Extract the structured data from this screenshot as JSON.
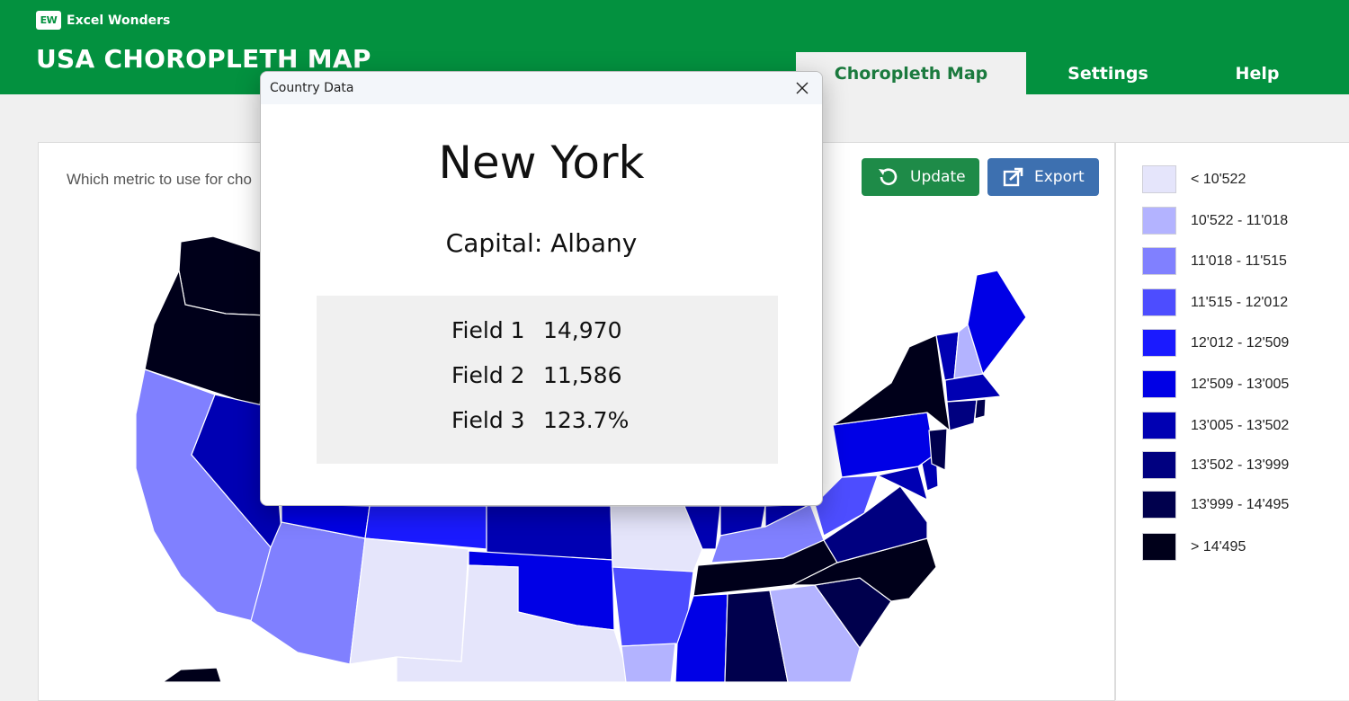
{
  "brand": {
    "logo_mark": "EW",
    "name": "Excel Wonders"
  },
  "app": {
    "title": "USA CHOROPLETH MAP"
  },
  "tabs": [
    {
      "label": "Choropleth Map",
      "active": true
    },
    {
      "label": "Settings",
      "active": false
    },
    {
      "label": "Help",
      "active": false
    }
  ],
  "toolbar": {
    "metric_prompt": "Which metric to use for cho",
    "update_label": "Update",
    "update_icon": "refresh-icon",
    "export_label": "Export",
    "export_icon": "export-icon"
  },
  "legend": [
    {
      "label": "< 10'522",
      "color": "#e5e5fb"
    },
    {
      "label": "10'522 - 11'018",
      "color": "#b3b3ff"
    },
    {
      "label": "11'018 - 11'515",
      "color": "#8080ff"
    },
    {
      "label": "11'515 - 12'012",
      "color": "#4d4dff"
    },
    {
      "label": "12'012 - 12'509",
      "color": "#1a1aff"
    },
    {
      "label": "12'509 - 13'005",
      "color": "#0000e6"
    },
    {
      "label": "13'005 - 13'502",
      "color": "#0000b3"
    },
    {
      "label": "13'502 - 13'999",
      "color": "#000080"
    },
    {
      "label": "13'999 - 14'495",
      "color": "#00004d"
    },
    {
      "label": "> 14'495",
      "color": "#00001a"
    }
  ],
  "dialog": {
    "title": "Country Data",
    "state": "New York",
    "capital": "Capital: Albany",
    "fields": [
      {
        "name": "Field 1",
        "value": "14,970"
      },
      {
        "name": "Field 2",
        "value": "11,586"
      },
      {
        "name": "Field 3",
        "value": "123.7%"
      }
    ]
  }
}
